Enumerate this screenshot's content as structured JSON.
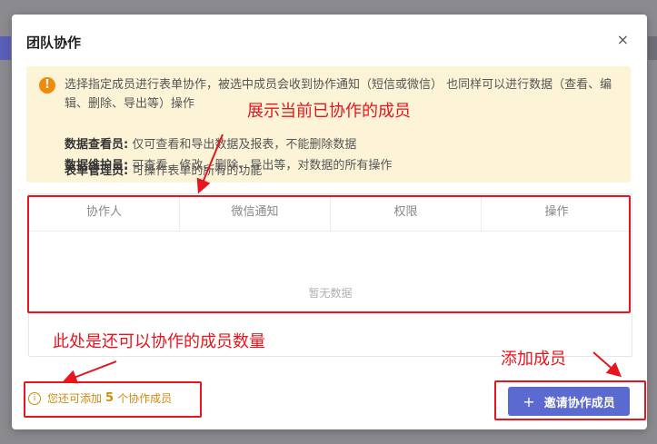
{
  "dialog": {
    "title": "团队协作",
    "close_label": "×"
  },
  "notice": {
    "text_part1": "选择指定成员进行表单协作，被选中成员会收到协作通知（短信或微信） 也同样可以进行数据（查看、编辑、删除、导出等）操作",
    "roles": [
      {
        "name": "数据查看员:",
        "desc": " 仅可查看和导出数据及报表，不能删除数据"
      },
      {
        "name": "数据维护员:",
        "desc": " 可查看、修改、删除、导出等，对数据的所有操作"
      },
      {
        "name": "表单管理员:",
        "desc": " 可操作表单的所有的功能"
      }
    ]
  },
  "table": {
    "columns": [
      "协作人",
      "微信通知",
      "权限",
      "操作"
    ],
    "empty_text": "暂无数据"
  },
  "footer": {
    "info_prefix": "您还可添加",
    "count": "5",
    "info_suffix": "个协作成员",
    "invite_label": "邀请协作成员"
  },
  "annotations": {
    "show_members": "展示当前已协作的成员",
    "member_count": "此处是还可以协作的成员数量",
    "add_member": "添加成员"
  },
  "colors": {
    "primary": "#5b6ad0",
    "warning": "#f08a0c",
    "annotation": "#e8141e",
    "notice_bg": "#fdf4d7"
  }
}
